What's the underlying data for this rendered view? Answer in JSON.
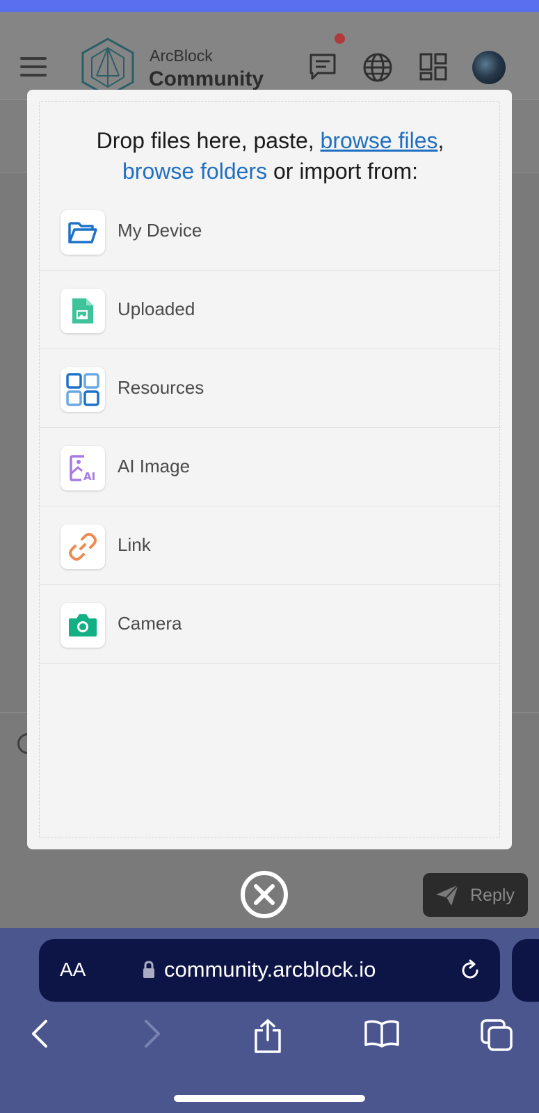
{
  "app": {
    "brand_top": "ArcBlock",
    "brand_main": "Community"
  },
  "upload_dialog": {
    "prompt_prefix": "Drop files here, paste, ",
    "browse_files_link": "browse files",
    "comma": ",",
    "browse_folders_link": "browse folders",
    "prompt_suffix": " or import from:",
    "sources": [
      {
        "label": "My Device",
        "icon": "folder-open-icon"
      },
      {
        "label": "Uploaded",
        "icon": "image-file-icon"
      },
      {
        "label": "Resources",
        "icon": "grid-icon"
      },
      {
        "label": "AI Image",
        "icon": "ai-image-icon"
      },
      {
        "label": "Link",
        "icon": "link-icon"
      },
      {
        "label": "Camera",
        "icon": "camera-icon"
      }
    ]
  },
  "reply_button": {
    "label": "Reply"
  },
  "browser": {
    "text_size_button": "AA",
    "url": "community.arcblock.io"
  },
  "colors": {
    "accent_strip": "#5a6ef0",
    "link": "#1f6fc2",
    "browser_bar": "#4b568f",
    "url_bar": "#0d1446"
  }
}
